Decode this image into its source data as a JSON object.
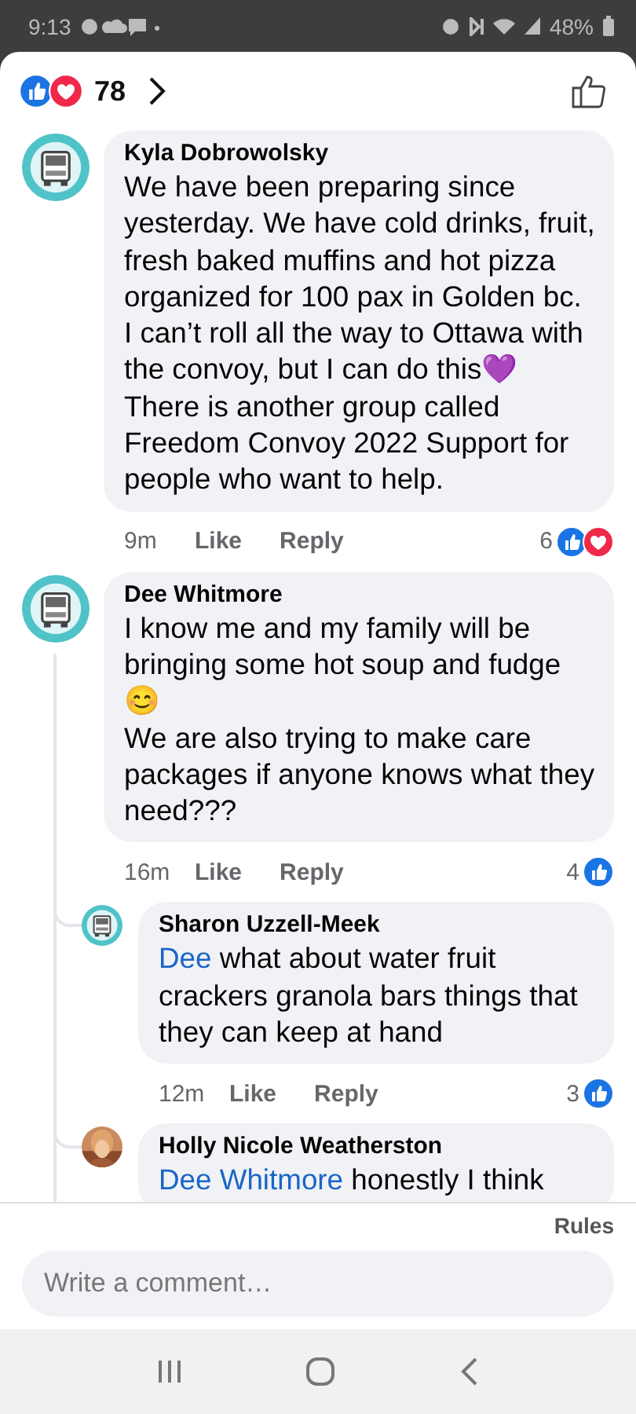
{
  "status_bar": {
    "time": "9:13",
    "battery": "48%"
  },
  "header": {
    "reaction_count": "78",
    "reactions": {
      "like": true,
      "love": true
    }
  },
  "comments": [
    {
      "author": "Kyla Dobrowolsky",
      "avatar": {
        "kind": "logo"
      },
      "text": "We have been preparing since yesterday. We have cold drinks, fruit, fresh baked muffins and hot pizza organized for 100 pax in Golden bc. I can’t roll all the way to Ottawa with the convoy, but I can do this💜\nThere is another group called Freedom Convoy 2022 Support for people who want to help.",
      "time": "9m",
      "like": "Like",
      "reply": "Reply",
      "reaction_count": "6",
      "reactions": {
        "like": true,
        "love": true
      }
    },
    {
      "author": "Dee Whitmore",
      "avatar": {
        "kind": "logo"
      },
      "text": "I know me and my family will be bringing some hot soup and fudge\n😊\nWe are also trying to make care packages if anyone knows what they need???",
      "time": "16m",
      "like": "Like",
      "reply": "Reply",
      "reaction_count": "4",
      "reactions": {
        "like": true,
        "love": false
      },
      "replies": [
        {
          "author": "Sharon Uzzell-Meek",
          "avatar": {
            "kind": "logo"
          },
          "mention": "Dee",
          "text": "what about water fruit crackers granola bars things that they can keep at hand",
          "time": "12m",
          "like": "Like",
          "reply": "Reply",
          "reaction_count": "3",
          "reactions": {
            "like": true,
            "love": false
          }
        },
        {
          "author": "Holly Nicole Weatherston",
          "mention": "Dee Whitmore",
          "text": "honestly I think"
        }
      ]
    }
  ],
  "rules": "Rules",
  "comment_field": {
    "placeholder": "Write a comment…"
  }
}
